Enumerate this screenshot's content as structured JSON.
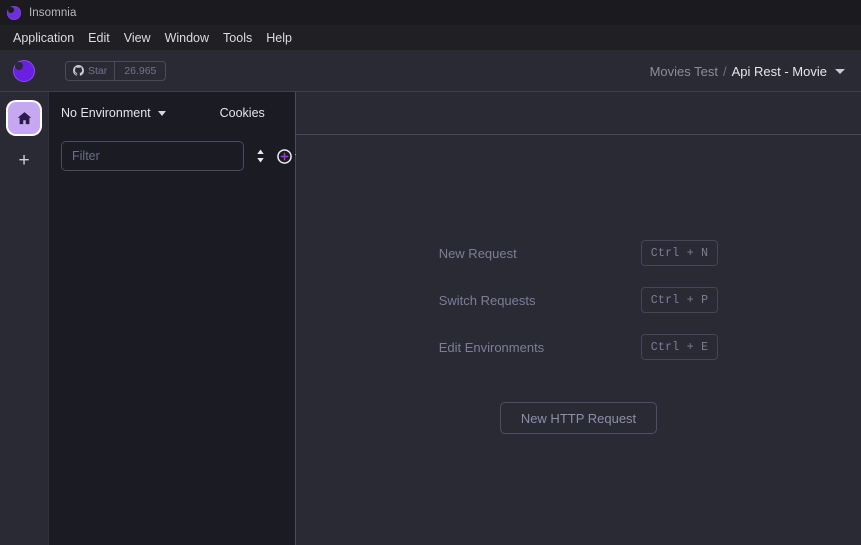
{
  "titlebar": {
    "app_name": "Insomnia",
    "logo_icon": "insomnia-logo-icon"
  },
  "menubar": {
    "items": [
      {
        "label": "Application"
      },
      {
        "label": "Edit"
      },
      {
        "label": "View"
      },
      {
        "label": "Window"
      },
      {
        "label": "Tools"
      },
      {
        "label": "Help"
      }
    ]
  },
  "toolbar": {
    "brand_icon": "insomnia-brand-icon",
    "github": {
      "icon": "github-icon",
      "label": "Star",
      "count": "26.965"
    },
    "breadcrumb": {
      "workspace": "Movies Test",
      "separator": "/",
      "active": "Api Rest - Movie",
      "caret_icon": "chevron-down-icon"
    }
  },
  "rail": {
    "home_icon": "home-icon",
    "add_label": "+"
  },
  "sidebar": {
    "environment_label": "No Environment",
    "environment_caret_icon": "chevron-down-icon",
    "cookies_label": "Cookies",
    "filter_placeholder": "Filter",
    "filter_value": "",
    "sort_icon": "sort-updown-icon",
    "add_icon": "plus-circle-icon",
    "add_caret_icon": "chevron-down-icon",
    "items": []
  },
  "main": {
    "shortcuts": [
      {
        "label": "New Request",
        "keys": "Ctrl + N"
      },
      {
        "label": "Switch Requests",
        "keys": "Ctrl + P"
      },
      {
        "label": "Edit Environments",
        "keys": "Ctrl + E"
      }
    ],
    "new_request_button": "New HTTP Request"
  },
  "colors": {
    "titlebar_bg": "#1b1b1f",
    "menubar_bg": "#202024",
    "panel_bg": "#2a2a35",
    "sidebar_bg": "#1a1b23",
    "accent_purple": "#6a20e0",
    "home_tile": "#c6a8f0",
    "muted_text": "#7d7d99"
  }
}
